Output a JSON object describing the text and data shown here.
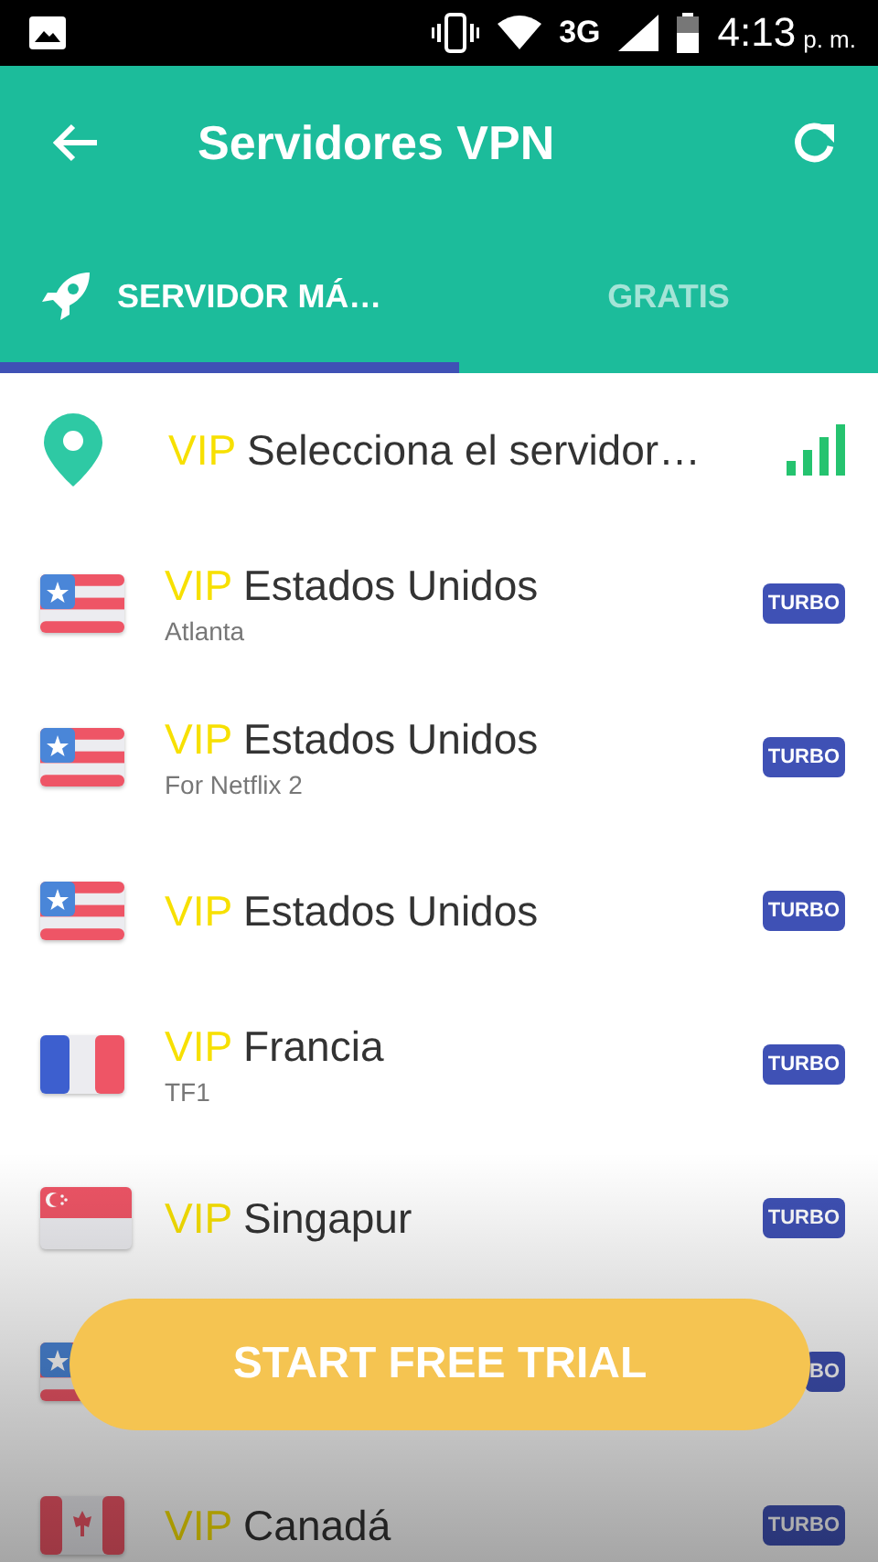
{
  "status_bar": {
    "network": "3G",
    "time": "4:13",
    "period": "p. m."
  },
  "toolbar": {
    "title": "Servidores VPN"
  },
  "tabs": [
    {
      "label": "SERVIDOR MÁ…",
      "selected": true
    },
    {
      "label": "GRATIS",
      "selected": false
    }
  ],
  "servers": [
    {
      "kind": "auto",
      "tier": "VIP",
      "name": "Selecciona el servidor…"
    },
    {
      "kind": "us",
      "tier": "VIP",
      "name": "Estados Unidos",
      "detail": "Atlanta",
      "badge": "TURBO"
    },
    {
      "kind": "us",
      "tier": "VIP",
      "name": "Estados Unidos",
      "detail": "For Netflix 2",
      "badge": "TURBO"
    },
    {
      "kind": "us",
      "tier": "VIP",
      "name": "Estados Unidos",
      "badge": "TURBO"
    },
    {
      "kind": "fr",
      "tier": "VIP",
      "name": "Francia",
      "detail": "TF1",
      "badge": "TURBO"
    },
    {
      "kind": "sg",
      "tier": "VIP",
      "name": "Singapur",
      "badge": "TURBO"
    },
    {
      "kind": "us",
      "badge": "BO"
    },
    {
      "kind": "ca",
      "tier": "VIP",
      "name": "Canadá",
      "badge": "TURBO"
    }
  ],
  "cta": {
    "label": "START FREE TRIAL"
  }
}
